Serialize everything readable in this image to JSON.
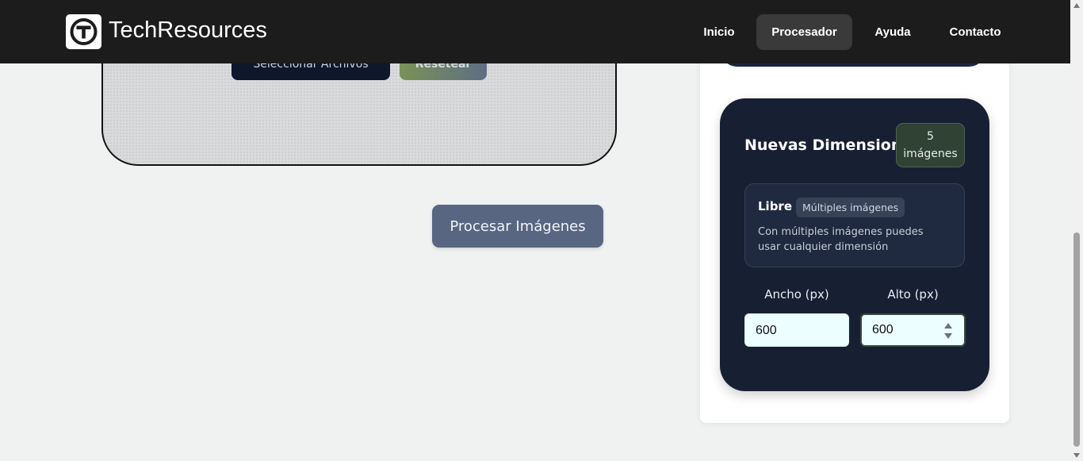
{
  "header": {
    "brand": "TechResources",
    "nav": [
      {
        "label": "Inicio",
        "active": false
      },
      {
        "label": "Procesador",
        "active": true
      },
      {
        "label": "Ayuda",
        "active": false
      },
      {
        "label": "Contacto",
        "active": false
      }
    ]
  },
  "upload": {
    "select_label": "Seleccionar Archivos",
    "reset_label": "Resetear"
  },
  "process_button": "Procesar Imágenes",
  "dimensions": {
    "title": "Nuevas Dimensiones",
    "count": "5",
    "count_unit": "imágenes",
    "mode": {
      "name": "Libre",
      "tag": "Múltiples imágenes",
      "description": "Con múltiples imágenes puedes usar cualquier dimensión"
    },
    "width_label": "Ancho (px)",
    "height_label": "Alto (px)",
    "width_value": "600",
    "height_value": "600"
  },
  "colors": {
    "navbar": "#1c1c1c",
    "card": "#172033",
    "input_bg": "#ecfeff",
    "process_button": "#586682"
  }
}
